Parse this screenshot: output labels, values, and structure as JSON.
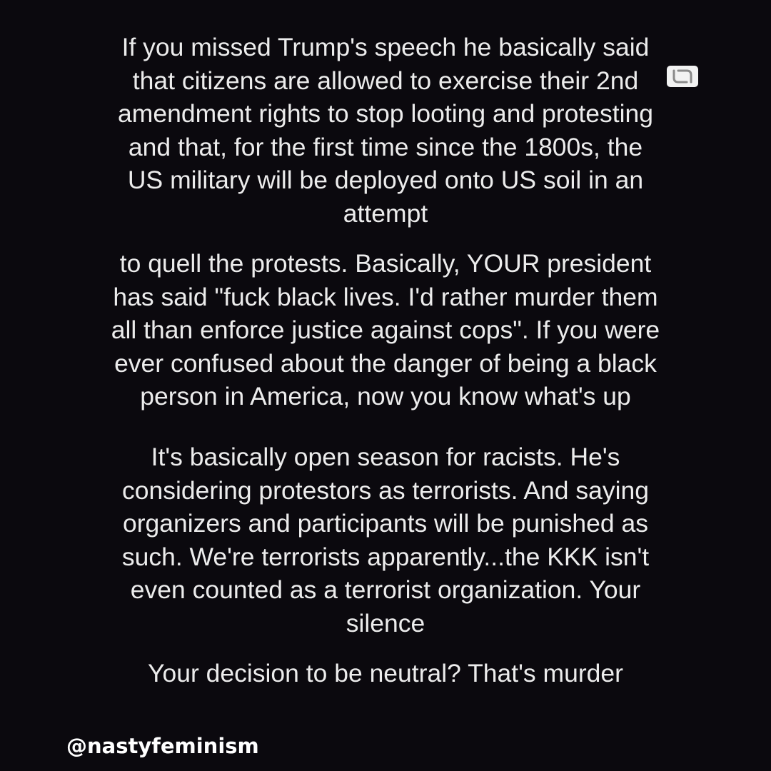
{
  "post": {
    "paragraphs": [
      {
        "lines": [
          "If you missed Trump's speech he basically said",
          "that citizens are allowed to exercise their 2nd",
          "amendment rights to stop looting and protesting",
          "and that, for the first time since the 1800s, the",
          "US military will be deployed onto US soil in an",
          "attempt"
        ]
      },
      {
        "lines": [
          "to quell the protests. Basically, YOUR president",
          "has said \"fuck black lives. I'd rather murder them",
          "all than enforce justice against cops\". If you were",
          "ever confused about the danger of being a black",
          "person in America, now you know what's up"
        ]
      },
      {
        "lines": [
          "It's basically open season for racists. He's",
          "considering protestors as terrorists. And saying",
          "organizers and participants will be punished as",
          "such. We're terrorists apparently...the KKK isn't",
          "even counted as a terrorist organization. Your",
          "silence"
        ]
      },
      {
        "lines": [
          "Your decision to be neutral? That's murder"
        ]
      }
    ],
    "handle": "@nastyfeminism",
    "repost_icon": "repost-icon",
    "colors": {
      "background": "#0b090e",
      "text": "#ececec",
      "handle": "#ffffff"
    }
  }
}
